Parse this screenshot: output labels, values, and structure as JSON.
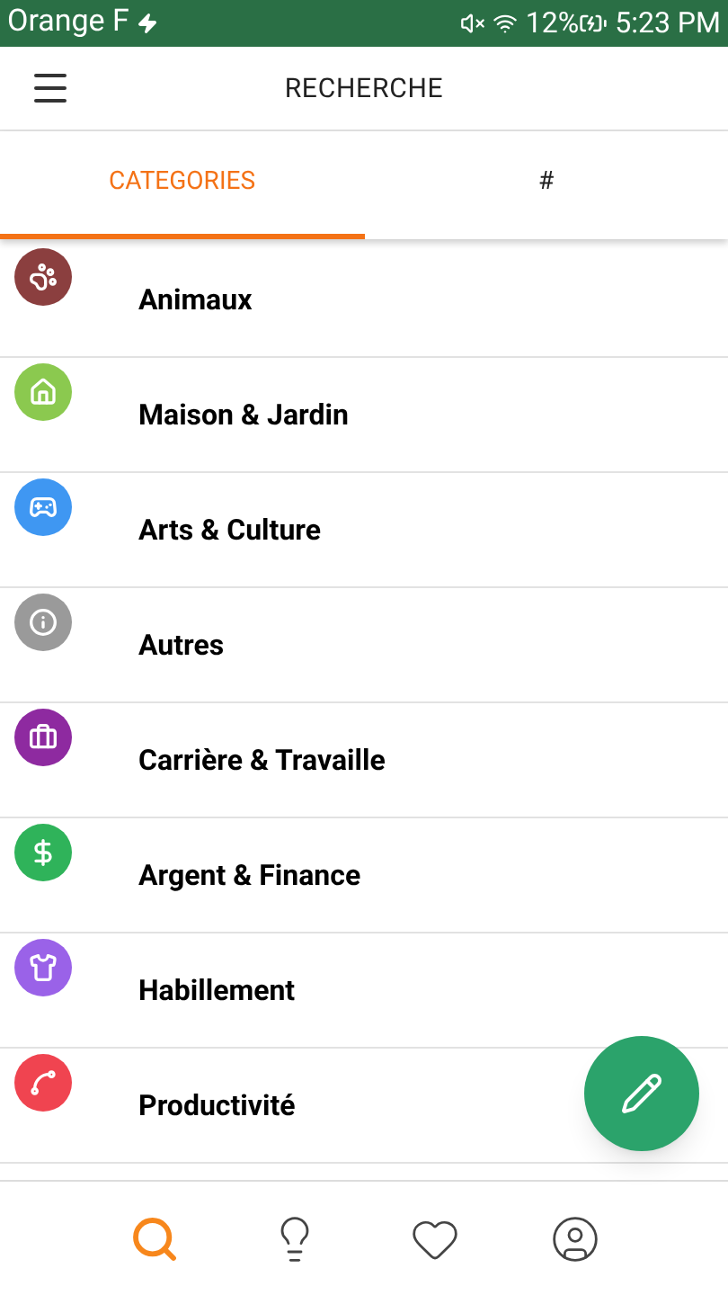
{
  "status_bar": {
    "carrier": "Orange F",
    "battery": "12%",
    "time": "5:23 PM"
  },
  "header": {
    "title": "RECHERCHE"
  },
  "tabs": [
    {
      "label": "CATEGORIES",
      "selected": true
    },
    {
      "label": "#",
      "selected": false
    }
  ],
  "categories": [
    {
      "label": "Animaux",
      "kind": "paw",
      "color": "#8b3f3f"
    },
    {
      "label": "Maison & Jardin",
      "kind": "house",
      "color": "#8bc94f"
    },
    {
      "label": "Arts & Culture",
      "kind": "gamepad",
      "color": "#3f97f2"
    },
    {
      "label": "Autres",
      "kind": "info",
      "color": "#9a9a9a"
    },
    {
      "label": "Carrière & Travaille",
      "kind": "briefcase",
      "color": "#8e2aa0"
    },
    {
      "label": "Argent & Finance",
      "kind": "dollar",
      "color": "#2fb35a"
    },
    {
      "label": "Habillement",
      "kind": "shirt",
      "color": "#9a62e8"
    },
    {
      "label": "Productivité",
      "kind": "chart",
      "color": "#f04450"
    }
  ],
  "bottom_nav": [
    {
      "kind": "search",
      "selected": true
    },
    {
      "kind": "bulb",
      "selected": false
    },
    {
      "kind": "heart",
      "selected": false
    },
    {
      "kind": "profile",
      "selected": false
    }
  ]
}
